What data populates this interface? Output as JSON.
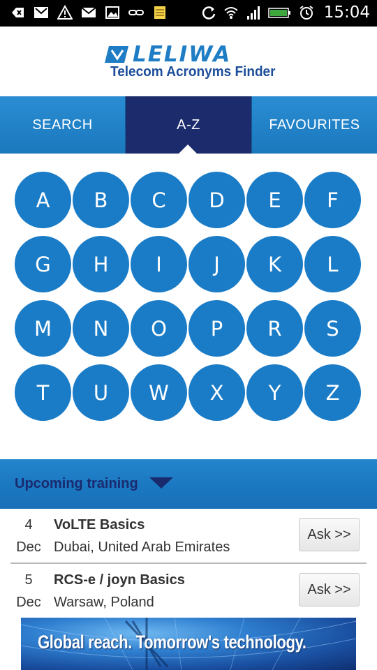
{
  "status_bar": {
    "time": "15:04",
    "left_icons": [
      "back-icon",
      "gmail-icon",
      "warning-icon",
      "mail-icon",
      "image-icon",
      "link-icon",
      "note-icon"
    ],
    "right_icons": [
      "sync-icon",
      "wifi-icon",
      "signal-icon",
      "battery-icon",
      "alarm-icon"
    ]
  },
  "header": {
    "brand": "LELIWA",
    "subtitle": "Telecom Acronyms Finder",
    "brand_color": "#1e7dc4"
  },
  "tabs": [
    {
      "label": "SEARCH",
      "active": false
    },
    {
      "label": "A-Z",
      "active": true
    },
    {
      "label": "FAVOURITES",
      "active": false
    }
  ],
  "letters": [
    "A",
    "B",
    "C",
    "D",
    "E",
    "F",
    "G",
    "H",
    "I",
    "J",
    "K",
    "L",
    "M",
    "N",
    "O",
    "P",
    "R",
    "S",
    "T",
    "U",
    "W",
    "X",
    "Y",
    "Z"
  ],
  "training": {
    "title": "Upcoming training",
    "items": [
      {
        "day": "4",
        "month": "Dec",
        "course": "VoLTE Basics",
        "place": "Dubai, United Arab Emirates",
        "action": "Ask >>"
      },
      {
        "day": "5",
        "month": "Dec",
        "course": "RCS-e / joyn Basics",
        "place": "Warsaw, Poland",
        "action": "Ask >>"
      }
    ]
  },
  "banner": {
    "text": "Global reach. Tomorrow's technology."
  },
  "colors": {
    "accent_blue": "#1a7cc7",
    "active_tab": "#1c2b6b",
    "training_title": "#1a2a6e"
  }
}
